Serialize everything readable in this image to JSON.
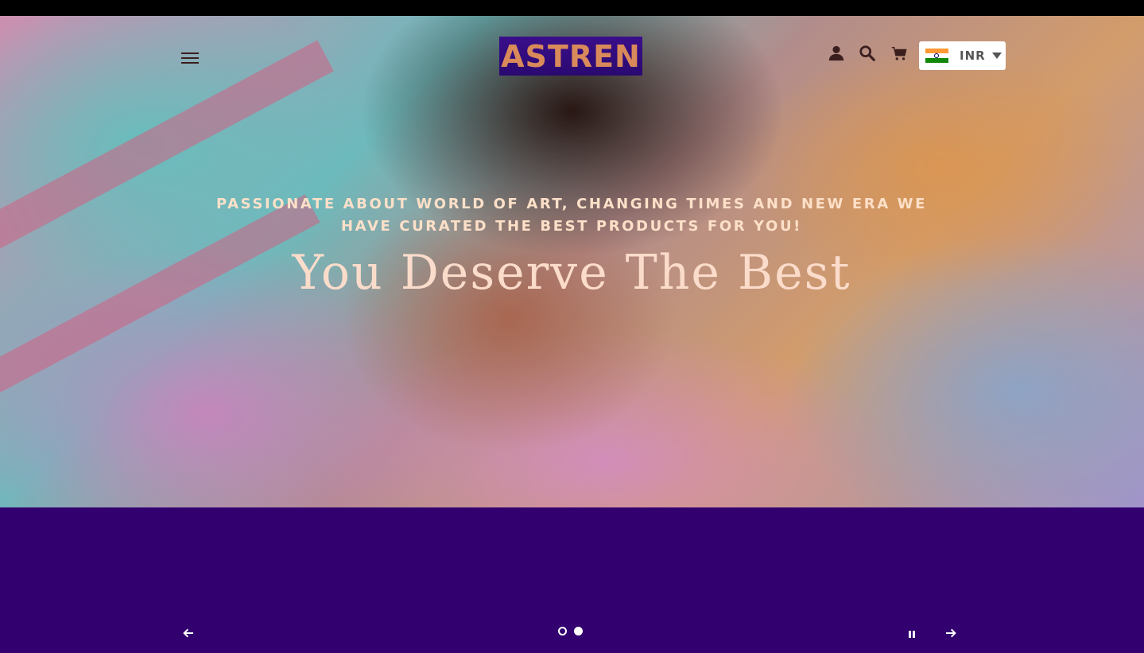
{
  "brand": {
    "logo_text": "ASTREN",
    "logo_bg": "#2a0970",
    "logo_text_color": "#d98a5a"
  },
  "header": {
    "menu_icon": "hamburger-icon",
    "icons": [
      "user-icon",
      "search-icon",
      "cart-icon"
    ],
    "currency": {
      "code": "INR",
      "flag": "india-flag-icon"
    }
  },
  "hero": {
    "tagline": "PASSIONATE ABOUT WORLD OF ART, CHANGING TIMES AND NEW ERA WE HAVE CURATED THE BEST PRODUCTS FOR YOU!",
    "headline": "You Deserve The Best",
    "text_color": "#fbdccb"
  },
  "slideshow": {
    "slide_count": 2,
    "active_slide": 2,
    "controls": [
      "prev-arrow-icon",
      "pause-icon",
      "next-arrow-icon"
    ]
  },
  "colors": {
    "footer_band": "#33006f",
    "top_bar": "#000000"
  }
}
